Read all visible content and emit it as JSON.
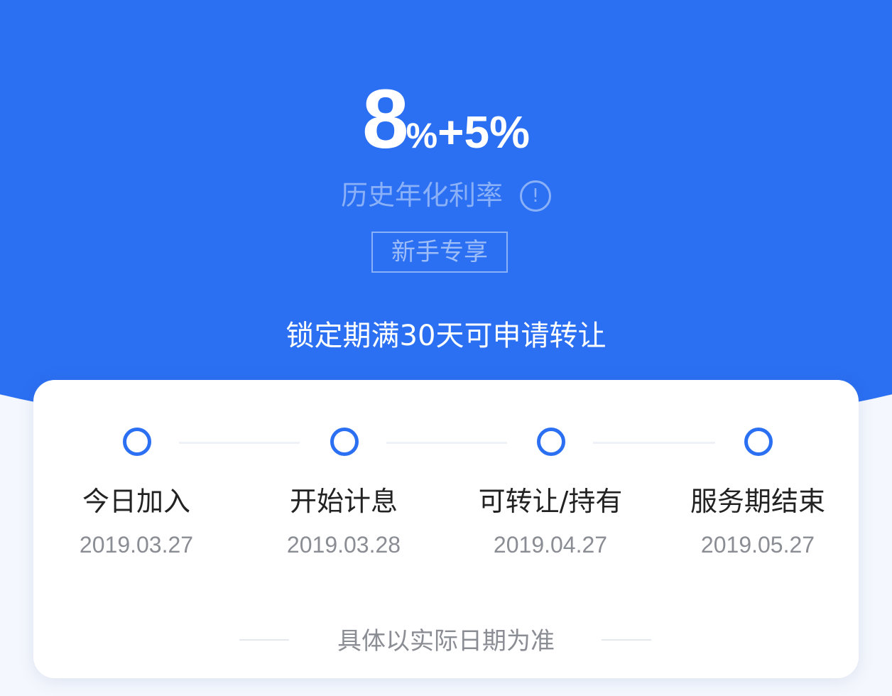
{
  "hero": {
    "rate_base": "8",
    "rate_base_unit": "%",
    "rate_extra": "+5%",
    "rate_label": "历史年化利率",
    "info_glyph": "!",
    "badge": "新手专享",
    "lock_notice": "锁定期满30天可申请转让",
    "background_color": "#2b6ff2"
  },
  "timeline": {
    "steps": [
      {
        "title": "今日加入",
        "date": "2019.03.27"
      },
      {
        "title": "开始计息",
        "date": "2019.03.28"
      },
      {
        "title": "可转让/持有",
        "date": "2019.04.27"
      },
      {
        "title": "服务期结束",
        "date": "2019.05.27"
      }
    ],
    "footnote": "具体以实际日期为准",
    "accent_color": "#2b6ff2"
  }
}
